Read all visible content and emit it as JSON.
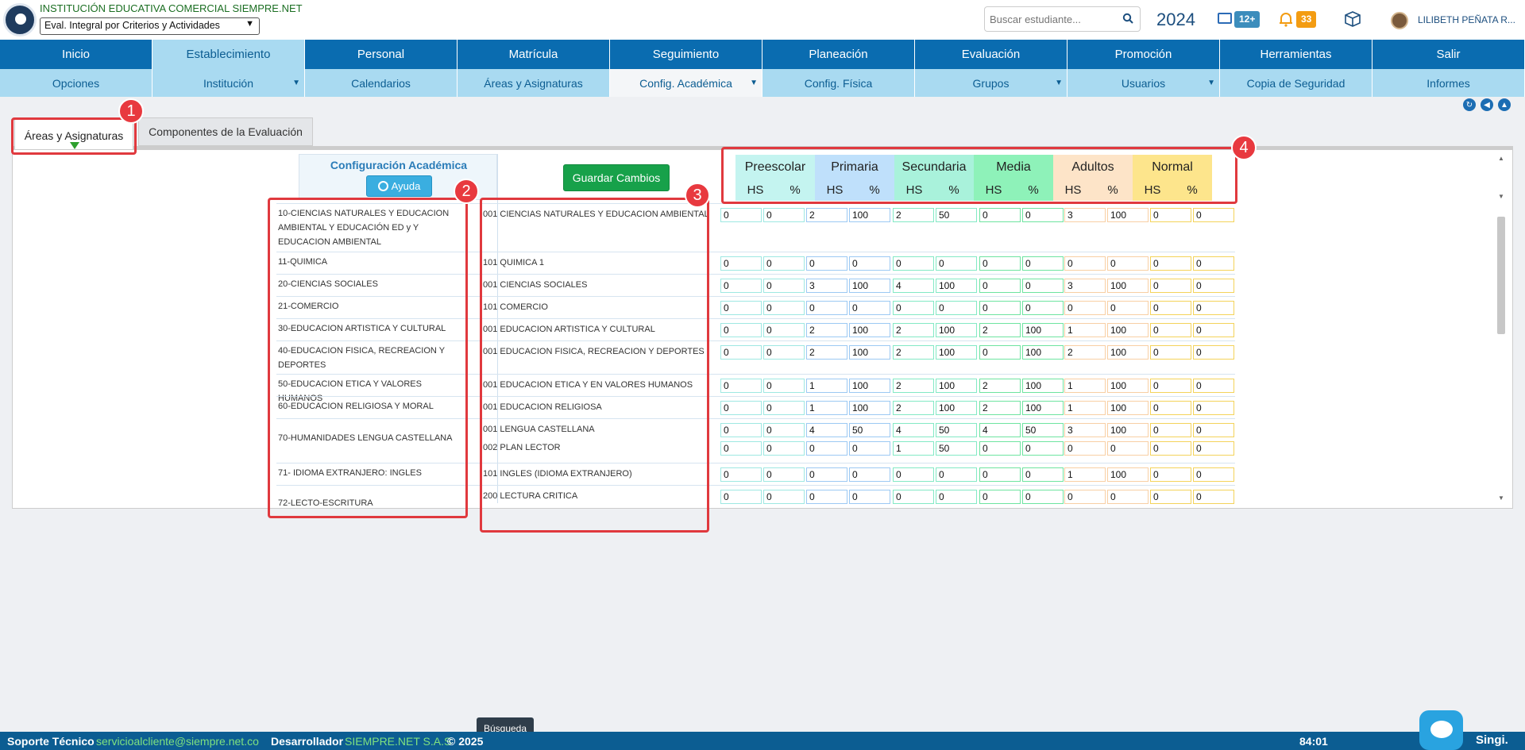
{
  "header": {
    "institution": "INSTITUCIÓN EDUCATIVA COMERCIAL SIEMPRE.NET",
    "eval_select": "Eval. Integral por Criterios y Actividades",
    "search_placeholder": "Buscar estudiante...",
    "year": "2024",
    "mail_count": "12+",
    "notif_count": "33",
    "user_name": "LILIBETH PEÑATA R..."
  },
  "menu1": [
    "Inicio",
    "Establecimiento",
    "Personal",
    "Matrícula",
    "Seguimiento",
    "Planeación",
    "Evaluación",
    "Promoción",
    "Herramientas",
    "Salir"
  ],
  "menu2": [
    "Opciones",
    "Institución",
    "Calendarios",
    "Áreas y Asignaturas",
    "Config. Académica",
    "Config. Física",
    "Grupos",
    "Usuarios",
    "Copia de Seguridad",
    "Informes"
  ],
  "tabs": [
    "Áreas y Asignaturas",
    "Componentes de la Evaluación"
  ],
  "config": {
    "title": "Configuración Académica",
    "help": "Ayuda",
    "save": "Guardar Cambios"
  },
  "levels": [
    "Preescolar",
    "Primaria",
    "Secundaria",
    "Media",
    "Adultos",
    "Normal"
  ],
  "level_colors": [
    "#c4f4f0",
    "#bfe0fb",
    "#a9f2db",
    "#8ef2b9",
    "#fde4c8",
    "#fde58c"
  ],
  "input_border_colors": [
    "#9ee8e2",
    "#9cc9f3",
    "#83e9c5",
    "#6ee4a0",
    "#f8cfa4",
    "#f4d35a"
  ],
  "sub_headers": [
    "HS",
    "%"
  ],
  "areas": [
    {
      "name": "10-CIENCIAS NATURALES Y EDUCACION AMBIENTAL Y EDUCACIÓN ED y Y EDUCACION AMBIENTAL",
      "subjects": [
        {
          "name": "001 CIENCIAS NATURALES Y EDUCACION AMBIENTAL",
          "values": [
            "0",
            "0",
            "2",
            "100",
            "2",
            "50",
            "0",
            "0",
            "3",
            "100",
            "0",
            "0"
          ]
        }
      ]
    },
    {
      "name": "11-QUIMICA",
      "subjects": [
        {
          "name": "101 QUIMICA 1",
          "values": [
            "0",
            "0",
            "0",
            "0",
            "0",
            "0",
            "0",
            "0",
            "0",
            "0",
            "0",
            "0"
          ]
        }
      ]
    },
    {
      "name": "20-CIENCIAS SOCIALES",
      "subjects": [
        {
          "name": "001 CIENCIAS SOCIALES",
          "values": [
            "0",
            "0",
            "3",
            "100",
            "4",
            "100",
            "0",
            "0",
            "3",
            "100",
            "0",
            "0"
          ]
        }
      ]
    },
    {
      "name": "21-COMERCIO",
      "subjects": [
        {
          "name": "101 COMERCIO",
          "values": [
            "0",
            "0",
            "0",
            "0",
            "0",
            "0",
            "0",
            "0",
            "0",
            "0",
            "0",
            "0"
          ]
        }
      ]
    },
    {
      "name": "30-EDUCACION ARTISTICA Y CULTURAL",
      "subjects": [
        {
          "name": "001 EDUCACION ARTISTICA Y CULTURAL",
          "values": [
            "0",
            "0",
            "2",
            "100",
            "2",
            "100",
            "2",
            "100",
            "1",
            "100",
            "0",
            "0"
          ]
        }
      ]
    },
    {
      "name": "40-EDUCACION FISICA, RECREACION Y DEPORTES",
      "subjects": [
        {
          "name": "001 EDUCACION FISICA, RECREACION Y DEPORTES",
          "values": [
            "0",
            "0",
            "2",
            "100",
            "2",
            "100",
            "0",
            "100",
            "2",
            "100",
            "0",
            "0"
          ]
        }
      ]
    },
    {
      "name": "50-EDUCACION ETICA Y VALORES HUMANOS",
      "subjects": [
        {
          "name": "001 EDUCACION ETICA Y EN VALORES HUMANOS",
          "values": [
            "0",
            "0",
            "1",
            "100",
            "2",
            "100",
            "2",
            "100",
            "1",
            "100",
            "0",
            "0"
          ]
        }
      ]
    },
    {
      "name": "60-EDUCACION RELIGIOSA Y MORAL",
      "subjects": [
        {
          "name": "001 EDUCACION RELIGIOSA",
          "values": [
            "0",
            "0",
            "1",
            "100",
            "2",
            "100",
            "2",
            "100",
            "1",
            "100",
            "0",
            "0"
          ]
        }
      ]
    },
    {
      "name": "70-HUMANIDADES LENGUA CASTELLANA",
      "subjects": [
        {
          "name": "001 LENGUA CASTELLANA",
          "values": [
            "0",
            "0",
            "4",
            "50",
            "4",
            "50",
            "4",
            "50",
            "3",
            "100",
            "0",
            "0"
          ]
        },
        {
          "name": "002 PLAN LECTOR",
          "values": [
            "0",
            "0",
            "0",
            "0",
            "1",
            "50",
            "0",
            "0",
            "0",
            "0",
            "0",
            "0"
          ]
        }
      ]
    },
    {
      "name": "71- IDIOMA EXTRANJERO: INGLES",
      "subjects": [
        {
          "name": "101 INGLES (IDIOMA EXTRANJERO)",
          "values": [
            "0",
            "0",
            "0",
            "0",
            "0",
            "0",
            "0",
            "0",
            "1",
            "100",
            "0",
            "0"
          ]
        }
      ]
    },
    {
      "name": "72-LECTO-ESCRITURA",
      "subjects": [
        {
          "name": "200 LECTURA CRITICA",
          "values": [
            "0",
            "0",
            "0",
            "0",
            "0",
            "0",
            "0",
            "0",
            "0",
            "0",
            "0",
            "0"
          ]
        }
      ]
    }
  ],
  "callouts": [
    "1",
    "2",
    "3",
    "4"
  ],
  "tooltip": "Búsqueda",
  "footer": {
    "support": "Soporte Técnico",
    "email": "servicioalcliente@siempre.net.co",
    "developer": "Desarrollador",
    "company": "SIEMPRE.NET S.A.S",
    "copyright": "© 2025",
    "time": "84:01",
    "brand": "Singi."
  }
}
